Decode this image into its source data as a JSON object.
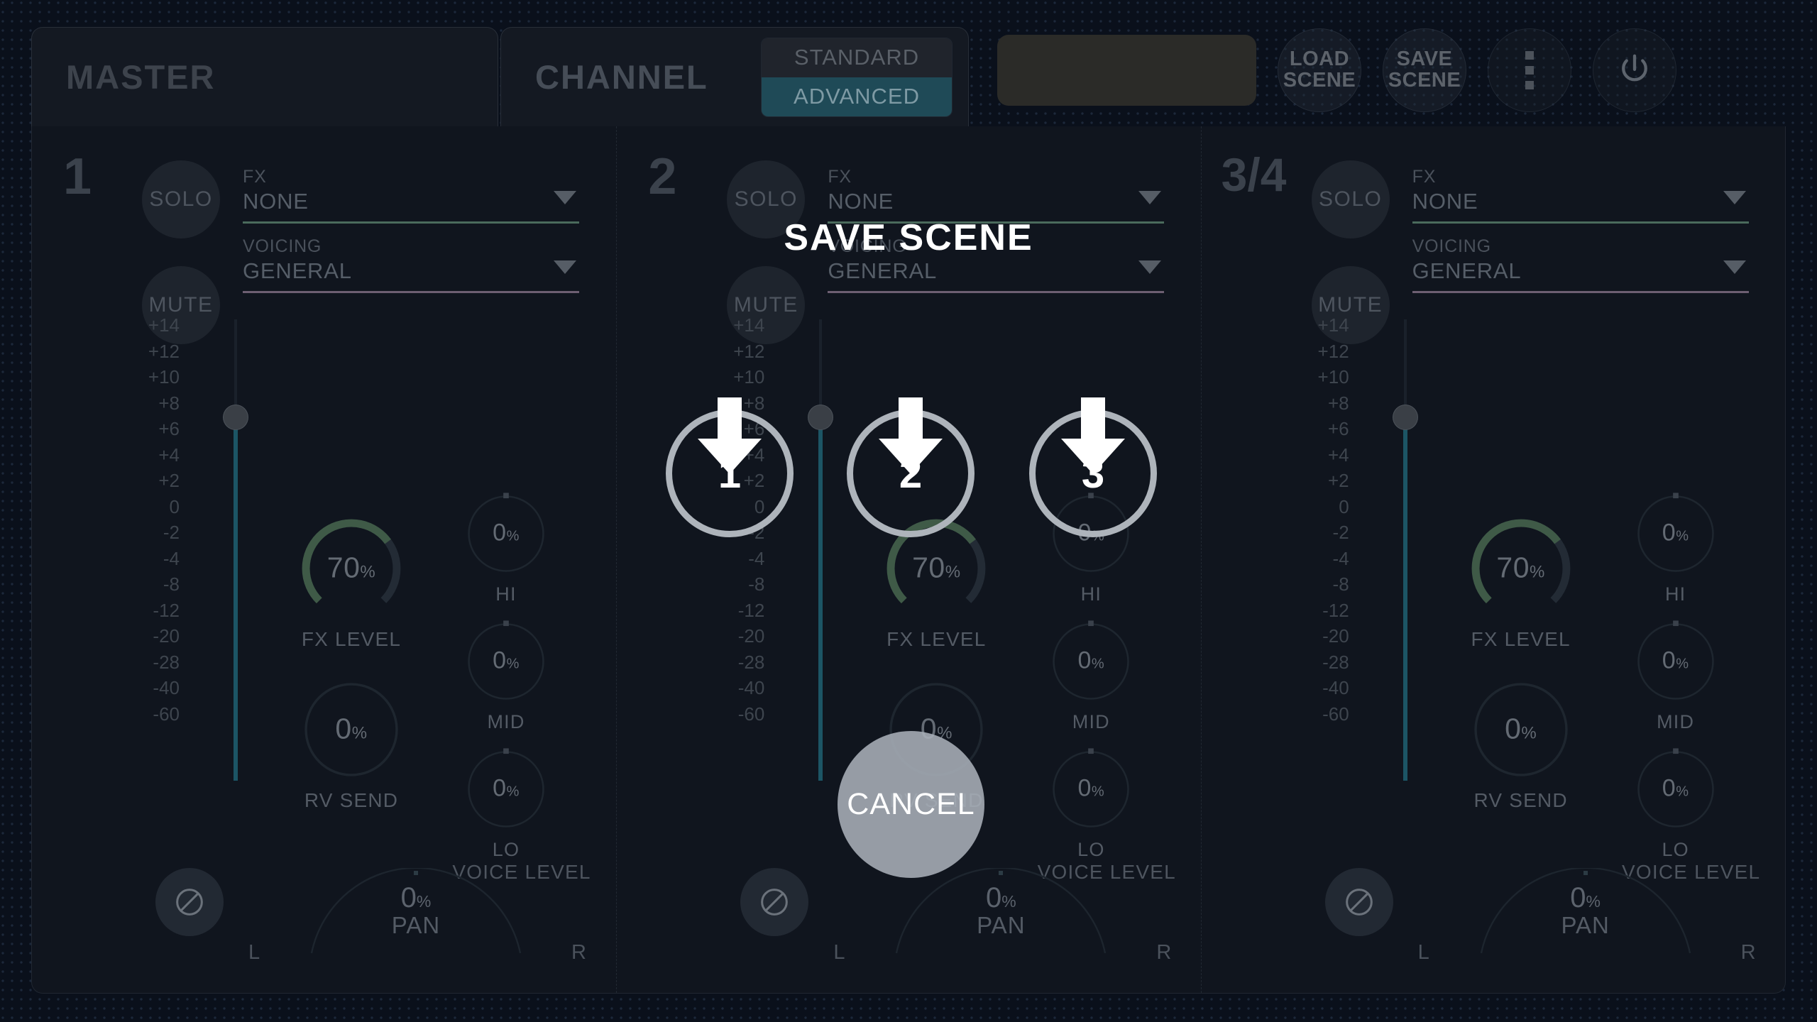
{
  "tabs": [
    {
      "label": "MASTER",
      "active": false
    },
    {
      "label": "CHANNEL",
      "active": true
    }
  ],
  "view_mode": {
    "standard_label": "STANDARD",
    "advanced_label": "ADVANCED",
    "selected": "ADVANCED"
  },
  "toolbar": {
    "scene_name_value": "",
    "load_scene_line1": "LOAD",
    "load_scene_line2": "SCENE",
    "save_scene_line1": "SAVE",
    "save_scene_line2": "SCENE",
    "menu_icon": "kebab-menu-icon",
    "power_icon": "power-icon"
  },
  "channels": [
    {
      "number": "1",
      "solo_label": "SOLO",
      "mute_label": "MUTE",
      "fx": {
        "caption": "FX",
        "value": "NONE"
      },
      "voicing": {
        "caption": "VOICING",
        "value": "GENERAL"
      },
      "fader": {
        "ticks": [
          "+14",
          "+12",
          "+10",
          "+8",
          "+6",
          "+4",
          "+2",
          "0",
          "-2",
          "-4",
          "-8",
          "-12",
          "-20",
          "-28",
          "-40",
          "-60"
        ],
        "position_db": "+6"
      },
      "fx_level": {
        "label": "FX LEVEL",
        "value": "70",
        "unit": "%"
      },
      "rv_send": {
        "label": "RV SEND",
        "value": "0",
        "unit": "%"
      },
      "eq": [
        {
          "label": "HI",
          "value": "0",
          "unit": "%"
        },
        {
          "label": "MID",
          "value": "0",
          "unit": "%"
        },
        {
          "label": "LO",
          "value": "0",
          "unit": "%"
        }
      ],
      "eq_group_label": "VOICE LEVEL",
      "phase_icon": "phase-invert-icon",
      "pan": {
        "label": "PAN",
        "value": "0",
        "unit": "%",
        "left": "L",
        "right": "R"
      }
    },
    {
      "number": "2",
      "solo_label": "SOLO",
      "mute_label": "MUTE",
      "fx": {
        "caption": "FX",
        "value": "NONE"
      },
      "voicing": {
        "caption": "VOICING",
        "value": "GENERAL"
      },
      "fader": {
        "ticks": [
          "+14",
          "+12",
          "+10",
          "+8",
          "+6",
          "+4",
          "+2",
          "0",
          "-2",
          "-4",
          "-8",
          "-12",
          "-20",
          "-28",
          "-40",
          "-60"
        ],
        "position_db": "+6"
      },
      "fx_level": {
        "label": "FX LEVEL",
        "value": "70",
        "unit": "%"
      },
      "rv_send": {
        "label": "RV SEND",
        "value": "0",
        "unit": "%"
      },
      "eq": [
        {
          "label": "HI",
          "value": "0",
          "unit": "%"
        },
        {
          "label": "MID",
          "value": "0",
          "unit": "%"
        },
        {
          "label": "LO",
          "value": "0",
          "unit": "%"
        }
      ],
      "eq_group_label": "VOICE LEVEL",
      "phase_icon": "phase-invert-icon",
      "pan": {
        "label": "PAN",
        "value": "0",
        "unit": "%",
        "left": "L",
        "right": "R"
      }
    },
    {
      "number": "3/4",
      "solo_label": "SOLO",
      "mute_label": "MUTE",
      "fx": {
        "caption": "FX",
        "value": "NONE"
      },
      "voicing": {
        "caption": "VOICING",
        "value": "GENERAL"
      },
      "fader": {
        "ticks": [
          "+14",
          "+12",
          "+10",
          "+8",
          "+6",
          "+4",
          "+2",
          "0",
          "-2",
          "-4",
          "-8",
          "-12",
          "-20",
          "-28",
          "-40",
          "-60"
        ],
        "position_db": "+6"
      },
      "fx_level": {
        "label": "FX LEVEL",
        "value": "70",
        "unit": "%"
      },
      "rv_send": {
        "label": "RV SEND",
        "value": "0",
        "unit": "%"
      },
      "eq": [
        {
          "label": "HI",
          "value": "0",
          "unit": "%"
        },
        {
          "label": "MID",
          "value": "0",
          "unit": "%"
        },
        {
          "label": "LO",
          "value": "0",
          "unit": "%"
        }
      ],
      "eq_group_label": "VOICE LEVEL",
      "phase_icon": "phase-invert-icon",
      "pan": {
        "label": "PAN",
        "value": "0",
        "unit": "%",
        "left": "L",
        "right": "R"
      }
    }
  ],
  "modal": {
    "title": "SAVE SCENE",
    "slots": [
      "1",
      "2",
      "3"
    ],
    "cancel_label": "CANCEL"
  },
  "colors": {
    "background": "#0a101b",
    "panel": "#10151e",
    "accent_teal": "#1f4a57",
    "fader_fill": "#1c5565",
    "fx_underline": "#4a6a5c",
    "voicing_underline": "#6d5f72",
    "knob_arc": "#3f5a47",
    "modal_ring": "#aeb4bb",
    "cancel_fill": "#a8afb8",
    "text_dim": "#545b65"
  }
}
